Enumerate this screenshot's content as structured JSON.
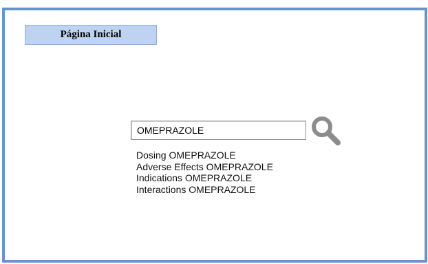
{
  "header": {
    "home_button_label": "Página Inicial"
  },
  "search": {
    "value": "OMEPRAZOLE",
    "icon": "search-icon"
  },
  "suggestions": [
    {
      "label": "Dosing OMEPRAZOLE"
    },
    {
      "label": "Adverse Effects OMEPRAZOLE"
    },
    {
      "label": "Indications OMEPRAZOLE"
    },
    {
      "label": "Interactions OMEPRAZOLE"
    }
  ],
  "colors": {
    "frame_border": "#6a93c9",
    "home_button_bg": "#bdd3ef",
    "search_icon": "#8c8c8c"
  }
}
